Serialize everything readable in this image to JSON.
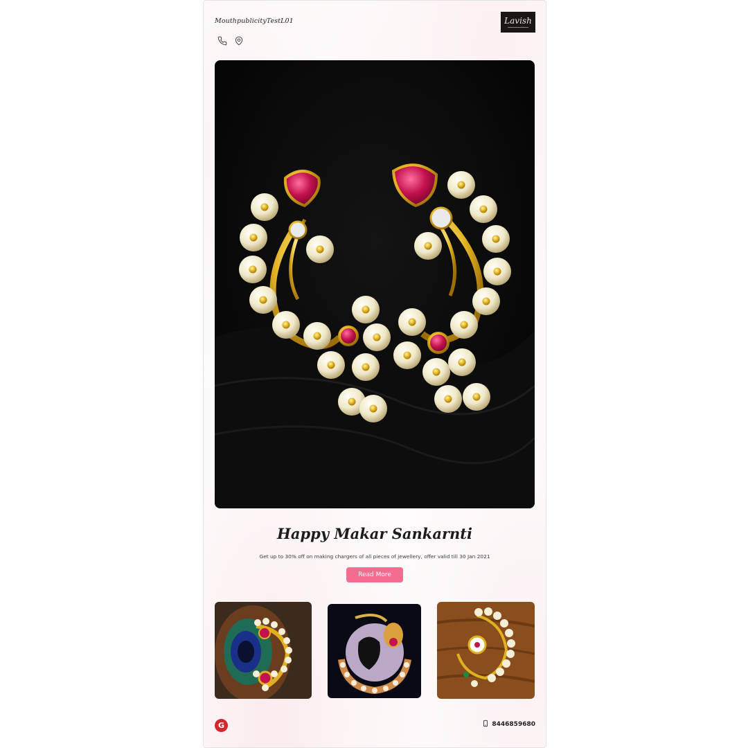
{
  "header": {
    "brand_name": "MouthpublicityTestL01",
    "logo_text": "Lavish",
    "icons": [
      "phone-icon",
      "location-pin-icon"
    ]
  },
  "hero": {
    "image": "gold-pearl-nath-earrings-on-black-fabric"
  },
  "offer": {
    "title": "Happy Makar Sankarnti",
    "description": "Get up to 30% off on making chargers of all pieces of jewellery, offer valid till 30 Jan 2021",
    "button_label": "Read More",
    "button_color": "#f26d8f"
  },
  "gallery": [
    {
      "image": "nath-on-peacock-feather"
    },
    {
      "image": "nath-with-peacock-silhouette"
    },
    {
      "image": "nath-on-wooden-background"
    }
  ],
  "footer": {
    "google_icon": "G",
    "phone_icon": "mobile-phone-icon",
    "phone": "8446859680"
  },
  "colors": {
    "accent": "#f26d8f",
    "google_red": "#d6262c",
    "logo_bg": "#1a1616"
  }
}
